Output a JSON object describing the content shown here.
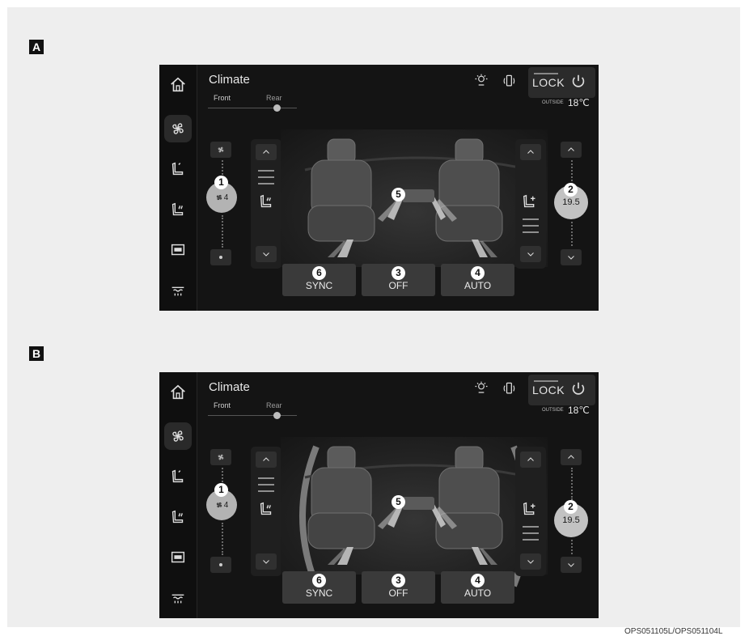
{
  "figures": [
    {
      "tag": "A",
      "title": "Climate",
      "front_label": "Front",
      "rear_label": "Rear",
      "lock_label": "LOCK",
      "outside_label": "OUTSIDE",
      "outside_temp": "18℃",
      "fan_speed": "4",
      "temperature": "19.5",
      "sync_label": "SYNC",
      "off_label": "OFF",
      "auto_label": "AUTO",
      "callouts": [
        "1",
        "2",
        "3",
        "4",
        "5",
        "6"
      ],
      "rear_arcs": false
    },
    {
      "tag": "B",
      "title": "Climate",
      "front_label": "Front",
      "rear_label": "Rear",
      "lock_label": "LOCK",
      "outside_label": "OUTSIDE",
      "outside_temp": "18℃",
      "fan_speed": "4",
      "temperature": "19.5",
      "sync_label": "SYNC",
      "off_label": "OFF",
      "auto_label": "AUTO",
      "callouts": [
        "1",
        "2",
        "3",
        "4",
        "5",
        "6"
      ],
      "rear_arcs": true
    }
  ],
  "sidebar_icons": [
    "home-icon",
    "fan-icon",
    "seat-icon",
    "seat-heat-icon",
    "media-icon",
    "defrost-icon"
  ],
  "status_icons": [
    "spc-icon",
    "phone-signal-icon",
    "power-icon"
  ],
  "footer_code": "OPS051105L/OPS051104L",
  "colors": {
    "background": "#eeeeee",
    "screen": "#141414",
    "button": "#3a3a3a",
    "accent_circle": "#b3b3b3"
  }
}
